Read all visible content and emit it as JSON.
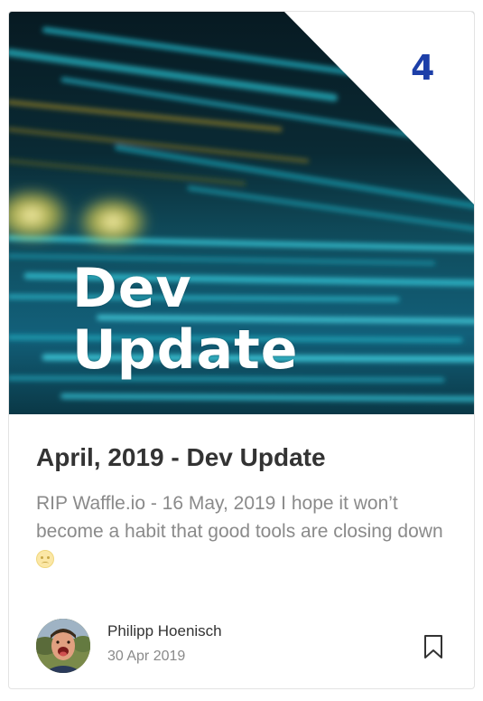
{
  "post": {
    "cover": {
      "line1": "Dev",
      "line2": "Update",
      "number": "4"
    },
    "title": "April, 2019 - Dev Update",
    "excerpt": "RIP Waffle.io - 16 May, 2019 I hope it won’t become a habit that good tools are closing down",
    "author": {
      "name": "Philipp Hoenisch",
      "date": "30 Apr 2019"
    }
  },
  "icons": {
    "emoji": "crying-face-icon",
    "bookmark": "bookmark-icon"
  },
  "colors": {
    "accent_number": "#1d3fa8",
    "title": "#333333",
    "excerpt": "#8a8a8a",
    "cover_teal": "#1ab4c8",
    "cover_dark": "#06141c"
  }
}
